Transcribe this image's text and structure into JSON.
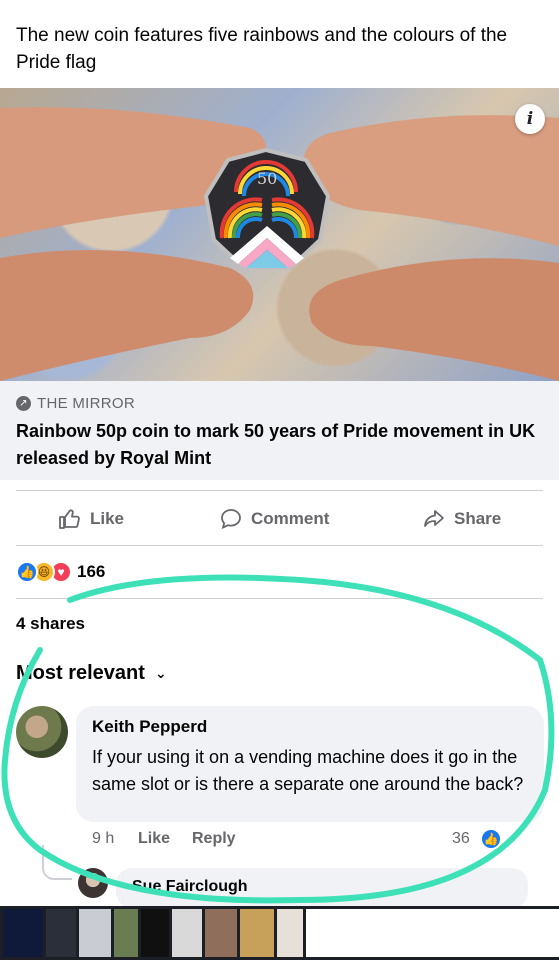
{
  "post": {
    "text": "The new coin features five rainbows and the colours of the Pride flag"
  },
  "link_card": {
    "info_icon": "i",
    "source": "THE MIRROR",
    "title": "Rainbow 50p coin to mark 50 years of Pride movement in UK released by Royal Mint"
  },
  "actions": {
    "like": "Like",
    "comment": "Comment",
    "share": "Share"
  },
  "reactions": {
    "count": "166"
  },
  "shares": {
    "text": "4 shares"
  },
  "sort": {
    "label": "Most relevant"
  },
  "comment": {
    "author": "Keith Pepperd",
    "text": "If your using it on a vending machine does it go in the same slot or is there a separate one around the back?",
    "time": "9 h",
    "like": "Like",
    "reply": "Reply",
    "reaction_count": "36"
  },
  "reply": {
    "author": "Sue Fairclough"
  },
  "colors": {
    "facebook_blue": "#1877f2",
    "annotation_stroke": "#3ee0b8",
    "secondary_text": "#65676b",
    "card_background": "#f0f2f5"
  }
}
